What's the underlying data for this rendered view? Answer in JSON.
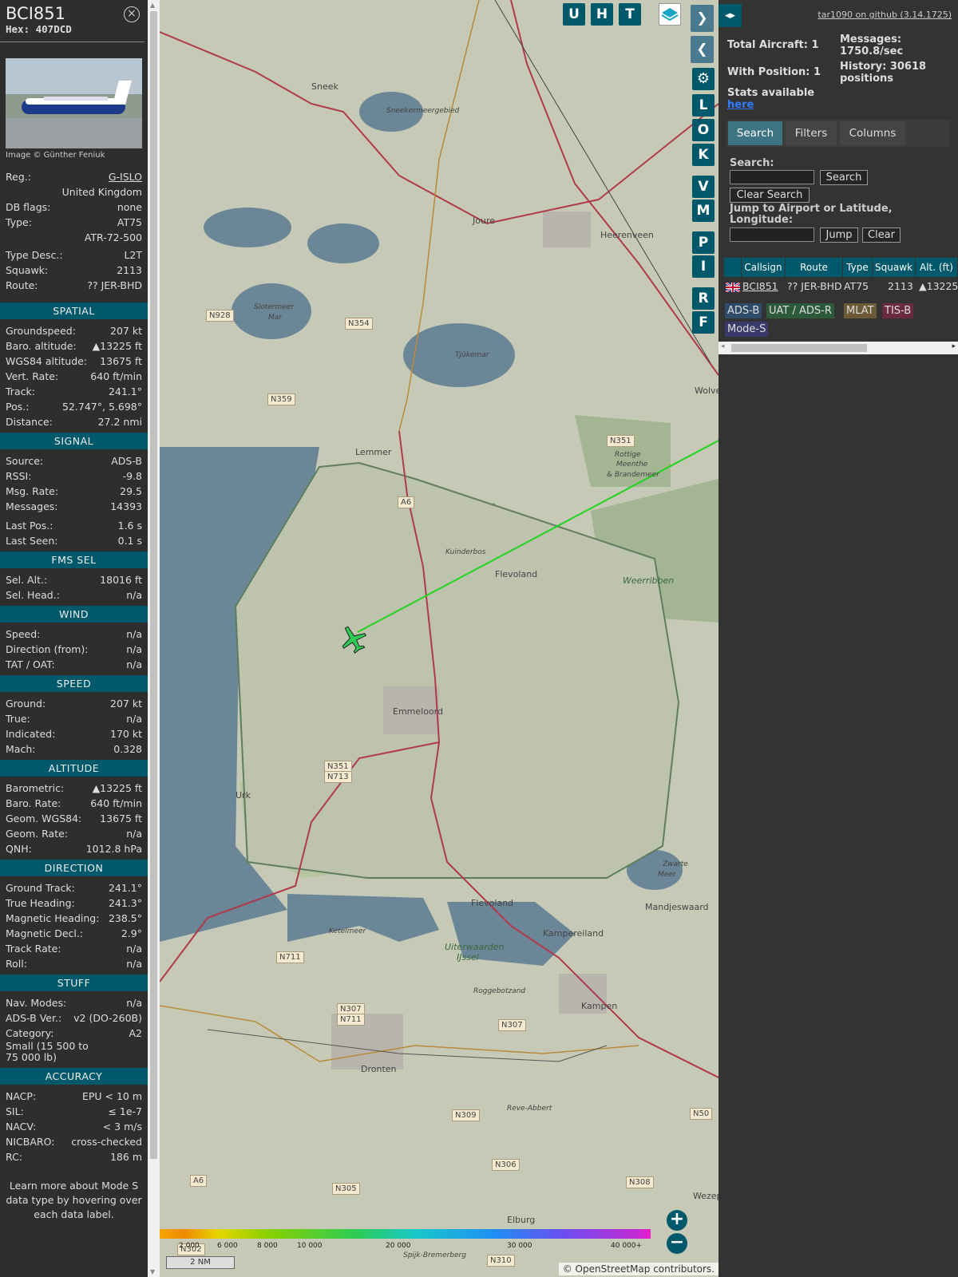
{
  "info": {
    "callsign": "BCI851",
    "hex": "Hex: 407DCD",
    "close_icon": "×",
    "photo_credit": "Image © Günther Feniuk",
    "reg_label": "Reg.:",
    "reg_value": "G-ISLO",
    "country": "United Kingdom",
    "dbflags_label": "DB flags:",
    "dbflags_value": "none",
    "type_label": "Type:",
    "type_value": "AT75",
    "type_full": "ATR-72-500",
    "typedesc_label": "Type Desc.:",
    "typedesc_value": "L2T",
    "squawk_label": "Squawk:",
    "squawk_value": "2113",
    "route_label": "Route:",
    "route_value": "?? JER-BHD",
    "sections": {
      "spatial": {
        "title": "SPATIAL",
        "rows": [
          [
            "Groundspeed:",
            "207 kt"
          ],
          [
            "Baro. altitude:",
            "▲13225 ft"
          ],
          [
            "WGS84 altitude:",
            "13675 ft"
          ],
          [
            "Vert. Rate:",
            "640 ft/min"
          ],
          [
            "Track:",
            "241.1°"
          ],
          [
            "Pos.:",
            "52.747°, 5.698°"
          ],
          [
            "Distance:",
            "27.2 nmi"
          ]
        ]
      },
      "signal": {
        "title": "SIGNAL",
        "rows": [
          [
            "Source:",
            "ADS-B"
          ],
          [
            "RSSI:",
            "-9.8"
          ],
          [
            "Msg. Rate:",
            "29.5"
          ],
          [
            "Messages:",
            "14393"
          ],
          [
            "Last Pos.:",
            "1.6 s"
          ],
          [
            "Last Seen:",
            "0.1 s"
          ]
        ]
      },
      "fms": {
        "title": "FMS SEL",
        "rows": [
          [
            "Sel. Alt.:",
            "18016 ft"
          ],
          [
            "Sel. Head.:",
            "n/a"
          ]
        ]
      },
      "wind": {
        "title": "WIND",
        "rows": [
          [
            "Speed:",
            "n/a"
          ],
          [
            "Direction (from):",
            "n/a"
          ],
          [
            "TAT / OAT:",
            "n/a"
          ]
        ]
      },
      "speed": {
        "title": "SPEED",
        "rows": [
          [
            "Ground:",
            "207 kt"
          ],
          [
            "True:",
            "n/a"
          ],
          [
            "Indicated:",
            "170 kt"
          ],
          [
            "Mach:",
            "0.328"
          ]
        ]
      },
      "altitude": {
        "title": "ALTITUDE",
        "rows": [
          [
            "Barometric:",
            "▲13225 ft"
          ],
          [
            "Baro. Rate:",
            "640 ft/min"
          ],
          [
            "Geom. WGS84:",
            "13675 ft"
          ],
          [
            "Geom. Rate:",
            "n/a"
          ],
          [
            "QNH:",
            "1012.8 hPa"
          ]
        ]
      },
      "direction": {
        "title": "DIRECTION",
        "rows": [
          [
            "Ground Track:",
            "241.1°"
          ],
          [
            "True Heading:",
            "241.3°"
          ],
          [
            "Magnetic Heading:",
            "238.5°"
          ],
          [
            "Magnetic Decl.:",
            "2.9°"
          ],
          [
            "Track Rate:",
            "n/a"
          ],
          [
            "Roll:",
            "n/a"
          ]
        ]
      },
      "stuff": {
        "title": "STUFF",
        "rows": [
          [
            "Nav. Modes:",
            "n/a"
          ],
          [
            "ADS-B Ver.:",
            "v2 (DO-260B)"
          ],
          [
            "Category:",
            "A2"
          ]
        ],
        "category_desc": "Small (15 500 to 75 000 lb)"
      },
      "accuracy": {
        "title": "ACCURACY",
        "rows": [
          [
            "NACP:",
            "EPU < 10 m"
          ],
          [
            "SIL:",
            "≤ 1e-7"
          ],
          [
            "NACV:",
            "< 3 m/s"
          ],
          [
            "NICBARO:",
            "cross-checked"
          ],
          [
            "RC:",
            "186 m"
          ]
        ]
      }
    },
    "learn": "Learn more about Mode S data type by hovering over each data label."
  },
  "map": {
    "buttons_left": [
      "U",
      "H",
      "T"
    ],
    "buttons_right": [
      "L",
      "O",
      "K",
      "V",
      "M",
      "P",
      "I",
      "R",
      "F"
    ],
    "labels": [
      "Sneek",
      "Sneekermeergebied",
      "Joure",
      "Heerenveen",
      "Slotermeer",
      "Mar",
      "Tjûkemar",
      "Lemmer",
      "Rottige",
      "Meenthe",
      "& Brandemeer",
      "Wolve",
      "Kuinderbos",
      "Flevoland",
      "Weerribben",
      "Emmeloord",
      "Urk",
      "Zwarte",
      "Meer",
      "Ketelmeer",
      "Flevoland",
      "Uiterwaarden",
      "IJssel",
      "Kampereiland",
      "Mandjeswaard",
      "Roggebotzand",
      "Kampen",
      "Dronten",
      "Reve-Abbert",
      "Elburg",
      "Spijk-Bremerberg",
      "Wezep"
    ],
    "roads": [
      "N928",
      "N354",
      "N359",
      "A6",
      "N351",
      "N351",
      "N713",
      "A6",
      "N711",
      "N307",
      "N711",
      "N307",
      "N309",
      "N306",
      "N305",
      "N308",
      "N310",
      "N302",
      "N50"
    ],
    "legend_ticks": [
      "2 000",
      "6 000",
      "8 000",
      "10 000",
      "20 000",
      "30 000",
      "40 000+"
    ],
    "scale": "2 NM",
    "attribution": "© OpenStreetMap contributors.",
    "zoom_in": "+",
    "zoom_out": "−"
  },
  "side": {
    "toggle": "◂▸",
    "github": "tar1090 on github (3.14.1725)",
    "total_aircraft": "Total Aircraft: 1",
    "with_position": "With Position: 1",
    "stats_available": "Stats available",
    "here": "here",
    "messages": "Messages: 1750.8/sec",
    "history": "History: 30618 positions",
    "tabs": [
      "Search",
      "Filters",
      "Columns"
    ],
    "search_label": "Search:",
    "search_btn": "Search",
    "clear_search": "Clear Search",
    "jump_label": "Jump to Airport or Latitude, Longitude:",
    "jump_btn": "Jump",
    "clear_btn": "Clear",
    "columns": [
      "Callsign",
      "Route",
      "Type",
      "Squawk",
      "Alt. (ft)"
    ],
    "row": {
      "callsign": "BCI851",
      "route": "?? JER-BHD",
      "type": "AT75",
      "squawk": "2113",
      "alt": "▲13225"
    },
    "pills": [
      "ADS-B",
      "UAT / ADS-R",
      "MLAT",
      "TIS-B",
      "Mode-S"
    ]
  }
}
